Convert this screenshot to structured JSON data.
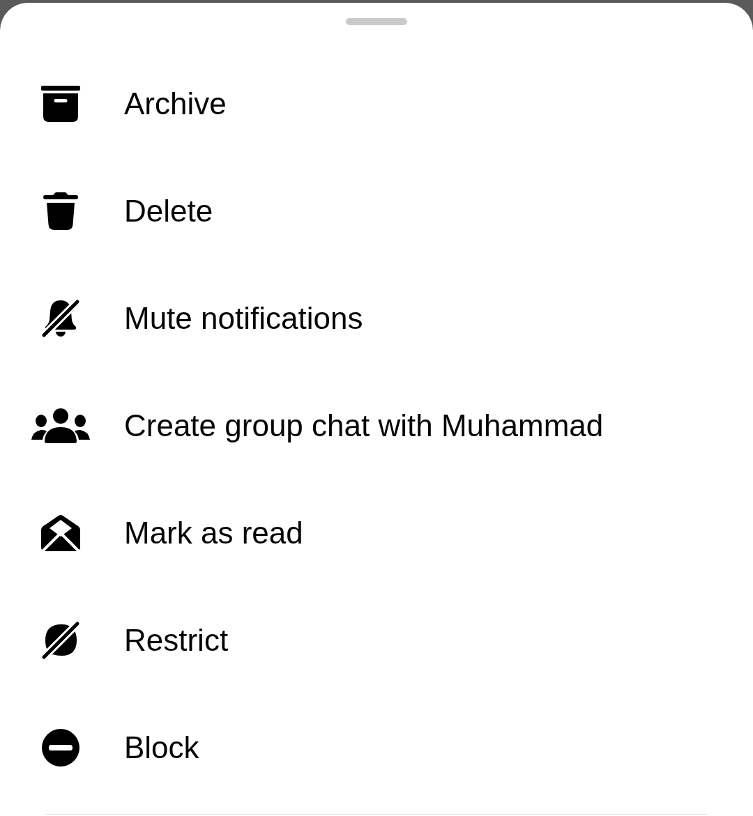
{
  "sheet": {
    "items": [
      {
        "label": "Archive"
      },
      {
        "label": "Delete"
      },
      {
        "label": "Mute notifications"
      },
      {
        "label": "Create group chat with Muhammad"
      },
      {
        "label": "Mark as read"
      },
      {
        "label": "Restrict"
      },
      {
        "label": "Block"
      }
    ]
  }
}
